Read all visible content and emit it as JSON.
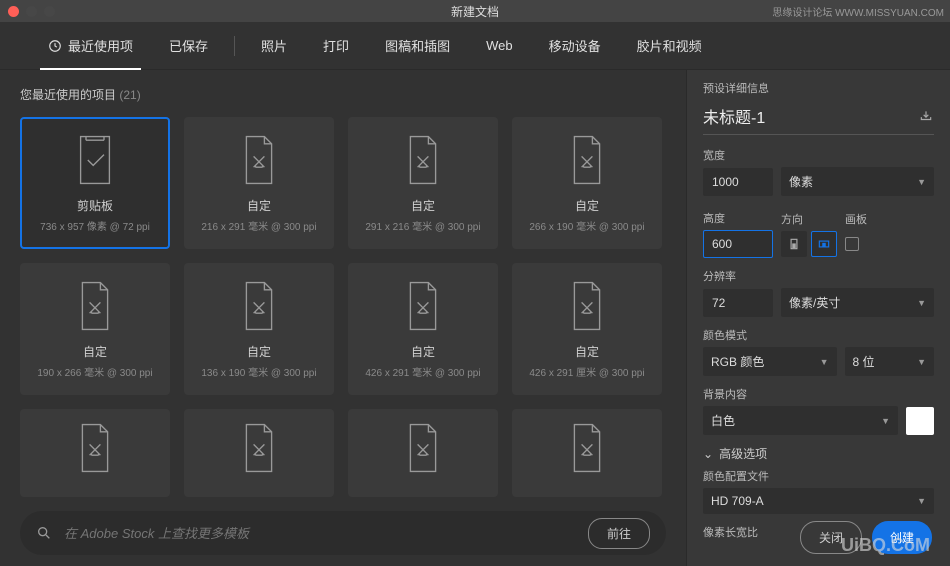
{
  "window": {
    "title": "新建文档",
    "watermark_top": "思缘设计论坛 WWW.MISSYUAN.COM"
  },
  "tabs": [
    {
      "label": "最近使用项",
      "active": true,
      "icon": "clock"
    },
    {
      "label": "已保存"
    },
    {
      "label": "照片"
    },
    {
      "label": "打印"
    },
    {
      "label": "图稿和插图"
    },
    {
      "label": "Web"
    },
    {
      "label": "移动设备"
    },
    {
      "label": "胶片和视频"
    }
  ],
  "recent": {
    "header": "您最近使用的项目",
    "count": "(21)"
  },
  "cards": [
    {
      "title": "剪贴板",
      "sub": "736 x 957 像素 @ 72 ppi",
      "selected": true,
      "icon": "clipboard"
    },
    {
      "title": "自定",
      "sub": "216 x 291 毫米 @ 300 ppi",
      "icon": "doc"
    },
    {
      "title": "自定",
      "sub": "291 x 216 毫米 @ 300 ppi",
      "icon": "doc"
    },
    {
      "title": "自定",
      "sub": "266 x 190 毫米 @ 300 ppi",
      "icon": "doc"
    },
    {
      "title": "自定",
      "sub": "190 x 266 毫米 @ 300 ppi",
      "icon": "doc"
    },
    {
      "title": "自定",
      "sub": "136 x 190 毫米 @ 300 ppi",
      "icon": "doc"
    },
    {
      "title": "自定",
      "sub": "426 x 291 毫米 @ 300 ppi",
      "icon": "doc"
    },
    {
      "title": "自定",
      "sub": "426 x 291 厘米 @ 300 ppi",
      "icon": "doc"
    },
    {
      "title": "",
      "sub": "",
      "icon": "doc",
      "short": true
    },
    {
      "title": "",
      "sub": "",
      "icon": "doc",
      "short": true
    },
    {
      "title": "",
      "sub": "",
      "icon": "doc",
      "short": true
    },
    {
      "title": "",
      "sub": "",
      "icon": "doc",
      "short": true
    }
  ],
  "stock": {
    "placeholder": "在 Adobe Stock 上查找更多模板",
    "go": "前往"
  },
  "details": {
    "header": "预设详细信息",
    "name": "未标题-1",
    "width_label": "宽度",
    "width_value": "1000",
    "width_unit": "像素",
    "height_label": "高度",
    "height_value": "600",
    "orient_label": "方向",
    "artboard_label": "画板",
    "res_label": "分辨率",
    "res_value": "72",
    "res_unit": "像素/英寸",
    "mode_label": "颜色模式",
    "mode_value": "RGB 颜色",
    "bits": "8 位",
    "bg_label": "背景内容",
    "bg_value": "白色",
    "adv_label": "高级选项",
    "profile_label": "颜色配置文件",
    "profile_value": "HD 709-A",
    "aspect_label": "像素长宽比"
  },
  "footer": {
    "close": "关闭",
    "create": "创建"
  },
  "watermark_bottom": "UiBQ.CoM"
}
